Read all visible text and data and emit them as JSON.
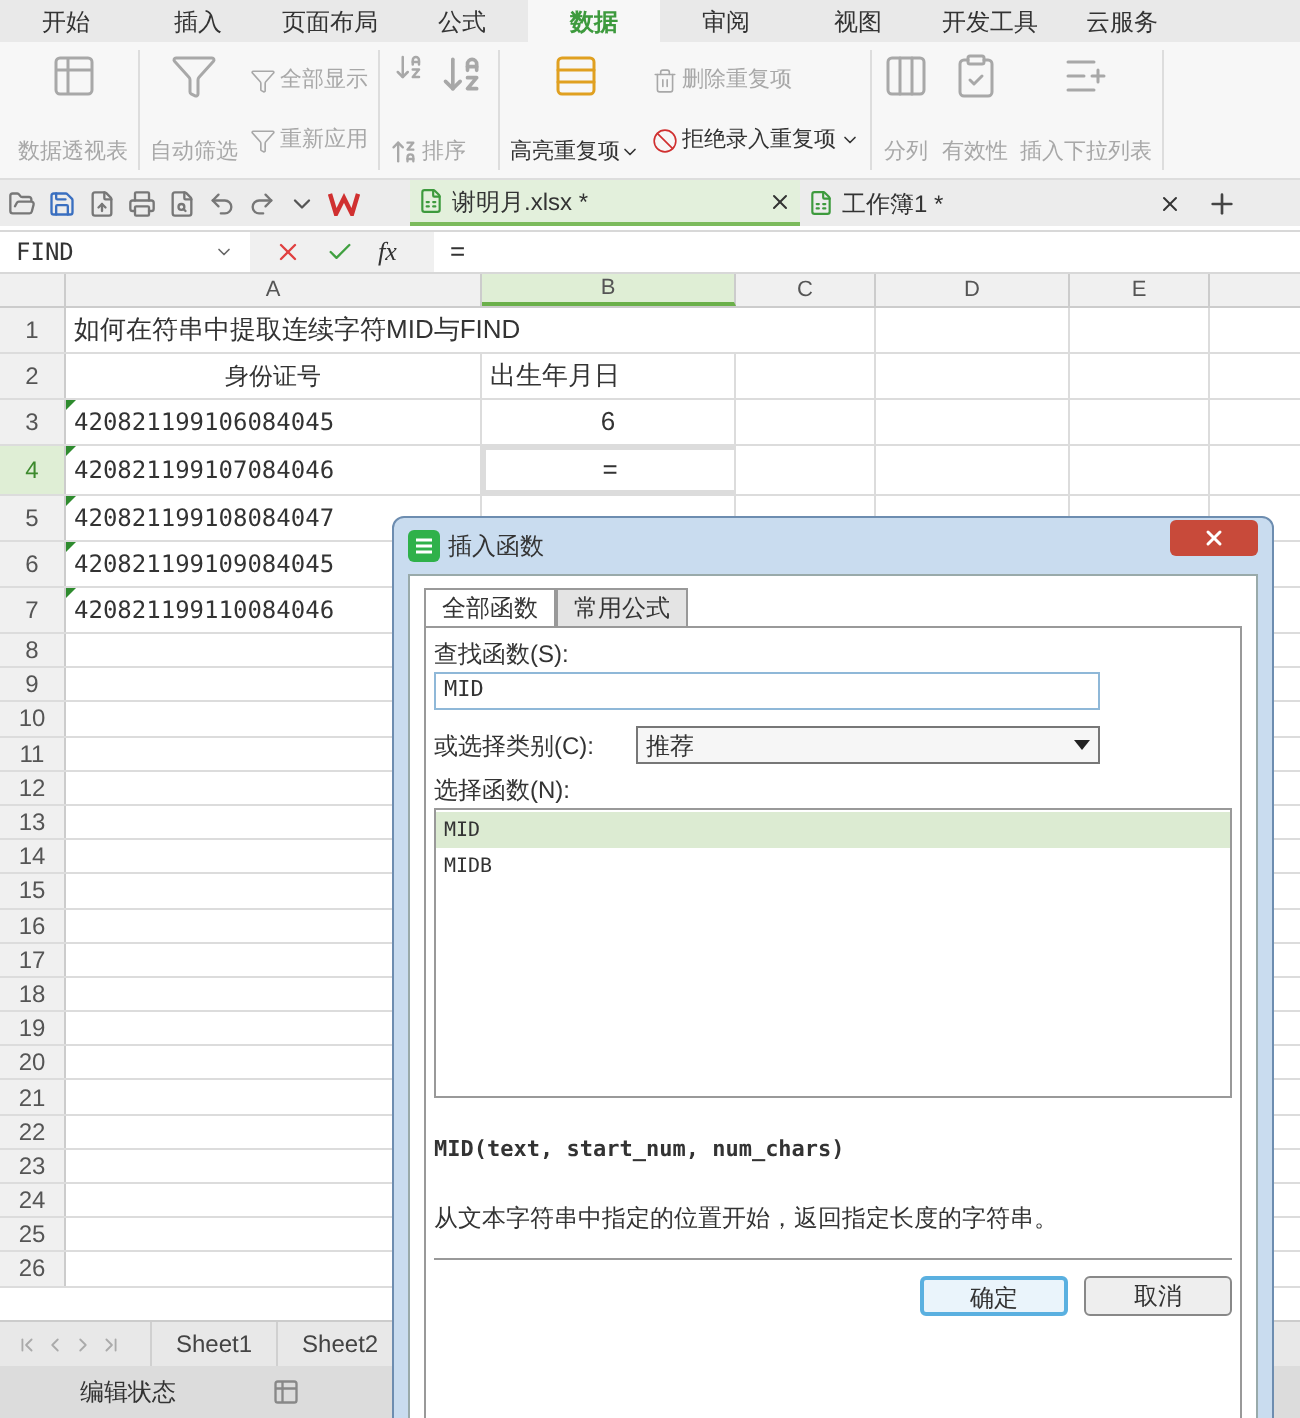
{
  "menu_tabs": [
    {
      "label": "开始",
      "selected": false
    },
    {
      "label": "插入",
      "selected": false
    },
    {
      "label": "页面布局",
      "selected": false
    },
    {
      "label": "公式",
      "selected": false
    },
    {
      "label": "数据",
      "selected": true
    },
    {
      "label": "审阅",
      "selected": false
    },
    {
      "label": "视图",
      "selected": false
    },
    {
      "label": "开发工具",
      "selected": false
    },
    {
      "label": "云服务",
      "selected": false
    }
  ],
  "ribbon_groups": [
    {
      "items": [
        {
          "kind": "large",
          "label": "数据透视表",
          "disabled": true,
          "dropdown": false
        }
      ]
    },
    {
      "items": [
        {
          "kind": "large",
          "label": "自动筛选",
          "disabled": true,
          "dropdown": false
        },
        {
          "kind": "small",
          "label": "全部显示",
          "disabled": true,
          "dropdown": false
        },
        {
          "kind": "small",
          "label": "重新应用",
          "disabled": true,
          "dropdown": false
        }
      ]
    },
    {
      "items": [
        {
          "kind": "sort",
          "label": "排序",
          "disabled": true,
          "dropdown": false
        }
      ]
    },
    {
      "items": [
        {
          "kind": "large",
          "label": "高亮重复项",
          "disabled": false,
          "dropdown": true
        },
        {
          "kind": "small",
          "label": "删除重复项",
          "disabled": true,
          "dropdown": false
        },
        {
          "kind": "small",
          "label": "拒绝录入重复项",
          "disabled": false,
          "dropdown": true
        }
      ]
    },
    {
      "items": [
        {
          "kind": "large",
          "label": "分列",
          "disabled": true,
          "dropdown": false
        },
        {
          "kind": "large",
          "label": "有效性",
          "disabled": true,
          "dropdown": false
        },
        {
          "kind": "large",
          "label": "插入下拉列表",
          "disabled": true,
          "dropdown": false
        }
      ]
    }
  ],
  "doc_tabs": [
    {
      "label": "谢明月.xlsx *",
      "selected": true
    },
    {
      "label": "工作簿1 *",
      "selected": false
    }
  ],
  "formula_bar": {
    "name_box": "FIND",
    "function_label": "fx",
    "formula": "="
  },
  "columns": [
    {
      "label": "A",
      "selected": false
    },
    {
      "label": "B",
      "selected": true
    },
    {
      "label": "C",
      "selected": false
    },
    {
      "label": "D",
      "selected": false
    },
    {
      "label": "E",
      "selected": false
    }
  ],
  "rows": [
    {
      "number": "1",
      "kind": "title",
      "selected": false,
      "a": "如何在符串中提取连续字符MID与FIND",
      "b": ""
    },
    {
      "number": "2",
      "kind": "header",
      "selected": false,
      "a": "身份证号",
      "b": "出生年月日"
    },
    {
      "number": "3",
      "kind": "data",
      "selected": false,
      "a": "420821199106084045",
      "b": "6"
    },
    {
      "number": "4",
      "kind": "data",
      "selected": true,
      "a": "420821199107084046",
      "b": "="
    },
    {
      "number": "5",
      "kind": "data",
      "selected": false,
      "a": "420821199108084047",
      "b": ""
    },
    {
      "number": "6",
      "kind": "data",
      "selected": false,
      "a": "420821199109084045",
      "b": ""
    },
    {
      "number": "7",
      "kind": "data",
      "selected": false,
      "a": "420821199110084046",
      "b": ""
    },
    {
      "number": "8",
      "kind": "empty",
      "selected": false,
      "a": "",
      "b": ""
    },
    {
      "number": "9",
      "kind": "empty",
      "selected": false,
      "a": "",
      "b": ""
    },
    {
      "number": "10",
      "kind": "empty",
      "selected": false,
      "a": "",
      "b": ""
    },
    {
      "number": "11",
      "kind": "empty",
      "selected": false,
      "a": "",
      "b": ""
    },
    {
      "number": "12",
      "kind": "empty",
      "selected": false,
      "a": "",
      "b": ""
    },
    {
      "number": "13",
      "kind": "empty",
      "selected": false,
      "a": "",
      "b": ""
    },
    {
      "number": "14",
      "kind": "empty",
      "selected": false,
      "a": "",
      "b": ""
    },
    {
      "number": "15",
      "kind": "empty",
      "selected": false,
      "a": "",
      "b": ""
    },
    {
      "number": "16",
      "kind": "empty",
      "selected": false,
      "a": "",
      "b": ""
    },
    {
      "number": "17",
      "kind": "empty",
      "selected": false,
      "a": "",
      "b": ""
    },
    {
      "number": "18",
      "kind": "empty",
      "selected": false,
      "a": "",
      "b": ""
    },
    {
      "number": "19",
      "kind": "empty",
      "selected": false,
      "a": "",
      "b": ""
    },
    {
      "number": "20",
      "kind": "empty",
      "selected": false,
      "a": "",
      "b": ""
    },
    {
      "number": "21",
      "kind": "empty",
      "selected": false,
      "a": "",
      "b": ""
    },
    {
      "number": "22",
      "kind": "empty",
      "selected": false,
      "a": "",
      "b": ""
    },
    {
      "number": "23",
      "kind": "empty",
      "selected": false,
      "a": "",
      "b": ""
    },
    {
      "number": "24",
      "kind": "empty",
      "selected": false,
      "a": "",
      "b": ""
    },
    {
      "number": "25",
      "kind": "empty",
      "selected": false,
      "a": "",
      "b": ""
    },
    {
      "number": "26",
      "kind": "empty",
      "selected": false,
      "a": "",
      "b": ""
    }
  ],
  "sheet_tabs": [
    "Sheet1",
    "Sheet2"
  ],
  "status_bar": {
    "text": "编辑状态"
  },
  "dialog": {
    "title": "插入函数",
    "tabs": [
      {
        "label": "全部函数",
        "selected": true
      },
      {
        "label": "常用公式",
        "selected": false
      }
    ],
    "search_label": "查找函数(S):",
    "search_value": "MID",
    "category_label": "或选择类别(C):",
    "category_value": "推荐",
    "list_label": "选择函数(N):",
    "functions": [
      {
        "name": "MID",
        "selected": true
      },
      {
        "name": "MIDB",
        "selected": false
      }
    ],
    "signature": "MID(text, start_num, num_chars)",
    "description": "从文本字符串中指定的位置开始，返回指定长度的字符串。",
    "buttons": [
      {
        "label": "确定",
        "default": true
      },
      {
        "label": "取消",
        "default": false
      }
    ]
  }
}
